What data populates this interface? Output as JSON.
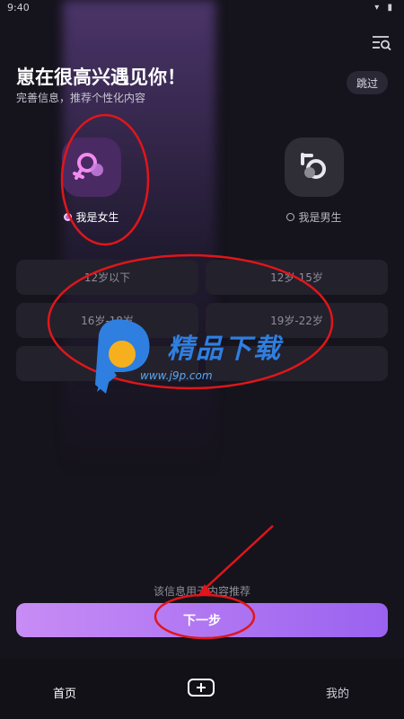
{
  "status_bar": {
    "time": "9:40",
    "icons": "▾ ▮"
  },
  "header": {
    "menu_icon": "menu-search-icon",
    "title": "崽在很高兴遇见你！",
    "subtitle": "完善信息，推荐个性化内容",
    "skip_label": "跳过"
  },
  "gender": {
    "female": {
      "label": "我是女生",
      "selected": true,
      "icon": "female-symbol-icon"
    },
    "male": {
      "label": "我是男生",
      "selected": false,
      "icon": "male-symbol-icon"
    }
  },
  "ages": [
    {
      "label": "12岁以下"
    },
    {
      "label": "12岁-15岁"
    },
    {
      "label": "16岁-18岁"
    },
    {
      "label": "19岁-22岁"
    },
    {
      "label": ""
    },
    {
      "label": ""
    }
  ],
  "hint": "该信息用于内容推荐",
  "next_label": "下一步",
  "nav": {
    "home": "首页",
    "add_icon": "plus-box-icon",
    "mine": "我的"
  },
  "watermark": {
    "brand": "精品下载",
    "url": "www.j9p.com"
  },
  "colors": {
    "accent_start": "#c88cf5",
    "accent_end": "#9a62f0",
    "annotation": "#e0161a",
    "background": "#15131c"
  }
}
